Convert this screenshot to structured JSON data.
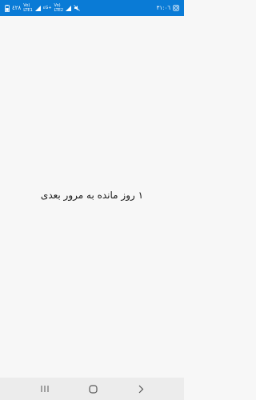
{
  "status_bar": {
    "bg_color": "#0a7bd6",
    "left": {
      "battery_text": "٤٢٨",
      "net1_top": "Vo)",
      "net1_bottom": "LTE1",
      "net1_right": "٤G+",
      "net2_top": "Vo)",
      "net2_bottom": "LTE2",
      "icons": [
        "battery-icon",
        "signal-sim1-icon",
        "signal-sim2-icon",
        "mute-icon"
      ]
    },
    "right": {
      "time": "٣١:٠٦",
      "icons": [
        "instagram-icon"
      ]
    }
  },
  "main": {
    "message": "۱ روز مانده به مرور بعدی"
  },
  "nav_bar": {
    "bg_color": "#ececec",
    "icons": [
      "recent-apps-icon",
      "home-icon",
      "back-icon"
    ]
  }
}
